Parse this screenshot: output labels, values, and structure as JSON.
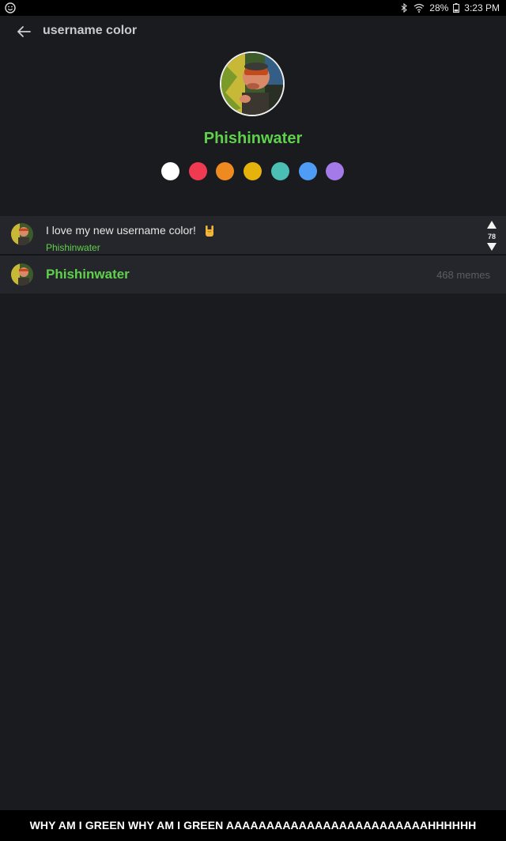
{
  "status_bar": {
    "battery": "28%",
    "time": "3:23 PM",
    "icons": [
      "smiley-icon",
      "bluetooth-icon",
      "wifi-icon",
      "battery-icon"
    ]
  },
  "header": {
    "title": "username color",
    "back_icon": "back-arrow-icon"
  },
  "profile": {
    "name": "Phishinwater",
    "name_color": "#5fd14a"
  },
  "color_options": [
    {
      "name": "white",
      "color": "#ffffff"
    },
    {
      "name": "red",
      "color": "#f03a52"
    },
    {
      "name": "orange",
      "color": "#ee8a1f"
    },
    {
      "name": "yellow",
      "color": "#e6b30c"
    },
    {
      "name": "teal",
      "color": "#4cbfb4"
    },
    {
      "name": "blue",
      "color": "#4e9cf5"
    },
    {
      "name": "purple",
      "color": "#a47ae9"
    }
  ],
  "comment": {
    "text": "I love my new username color!",
    "emoji": "rock-on-hand-icon",
    "author": "Phishinwater",
    "votes": "78"
  },
  "user_row": {
    "name": "Phishinwater",
    "memes": "468 memes"
  },
  "caption": {
    "text": "WHY AM I GREEN WHY AM I GREEN  AAAAAAAAAAAAAAAAAAAAAAAAAHHHHHH"
  }
}
